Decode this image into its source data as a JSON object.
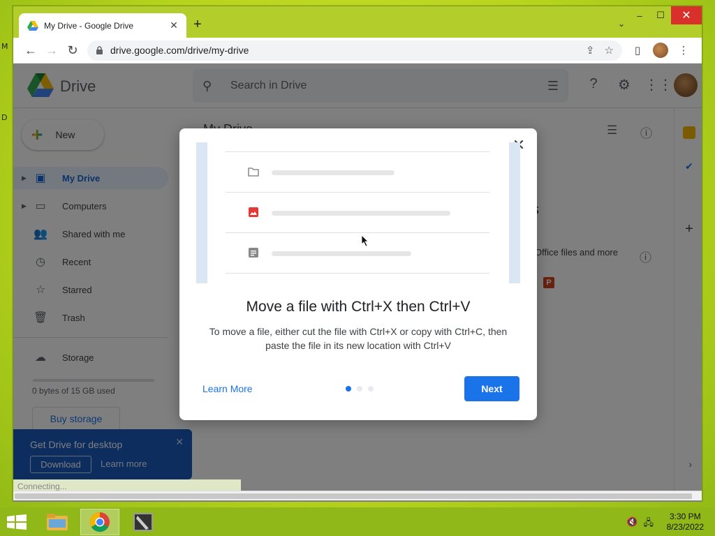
{
  "browser": {
    "tab_title": "My Drive - Google Drive",
    "tab_close": "✕",
    "new_tab": "+",
    "tab_dropdown": "⌄",
    "url": "drive.google.com/drive/my-drive",
    "window_controls": {
      "minimize": "–",
      "maximize": "☐",
      "close": "✕"
    }
  },
  "drive": {
    "logo_text": "Drive",
    "search_placeholder": "Search in Drive",
    "new_button": "New",
    "sidebar": [
      {
        "label": "My Drive",
        "icon": "my-drive-icon",
        "active": true
      },
      {
        "label": "Computers",
        "icon": "computers-icon"
      },
      {
        "label": "Shared with me",
        "icon": "shared-icon"
      },
      {
        "label": "Recent",
        "icon": "clock-icon"
      },
      {
        "label": "Starred",
        "icon": "star-icon"
      },
      {
        "label": "Trash",
        "icon": "trash-icon"
      }
    ],
    "storage_label": "Storage",
    "storage_used": "0 bytes of 15 GB used",
    "buy_storage": "Buy storage",
    "main_title": "My Drive",
    "bg_heading_fragment": "s",
    "bg_office_text": "Office files and more",
    "bg_file_badge": "P"
  },
  "promo": {
    "title": "Get Drive for desktop",
    "close": "✕",
    "download": "Download",
    "learn_more": "Learn more"
  },
  "status_text": "Connecting...",
  "dialog": {
    "close": "✕",
    "title": "Move a file with Ctrl+X then Ctrl+V",
    "body": "To move a file, either cut the file with Ctrl+X or copy with Ctrl+C, then paste the file in its new location with Ctrl+V",
    "learn_more": "Learn More",
    "next": "Next",
    "page_current": 1,
    "page_total": 3
  },
  "taskbar": {
    "time": "3:30 PM",
    "date": "8/23/2022"
  },
  "colors": {
    "accent": "#1a73e8",
    "promo_bg": "#185abc",
    "desktop": "#b5d21c"
  }
}
